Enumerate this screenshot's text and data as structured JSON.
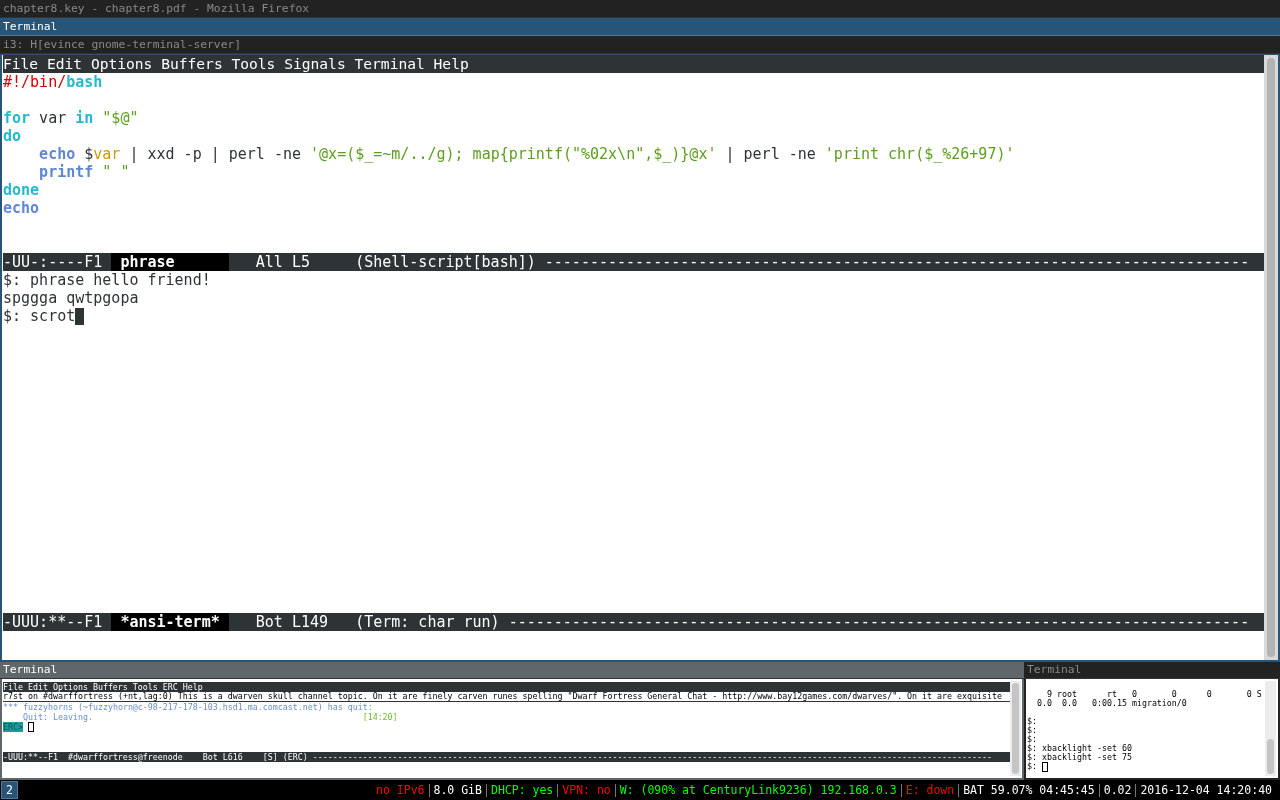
{
  "stack_titles": [
    {
      "title": "chapter8.key - chapter8.pdf - Mozilla Firefox",
      "selected": false
    },
    {
      "title": "Terminal",
      "selected": true
    },
    {
      "title": "i3: H[evince gnome-terminal-server]",
      "selected": false
    }
  ],
  "emacs": {
    "menu": [
      "File",
      "Edit",
      "Options",
      "Buffers",
      "Tools",
      "Signals",
      "Terminal",
      "Help"
    ],
    "script_buffer": {
      "lines": [
        {
          "kind": "code",
          "segments": [
            {
              "text": "#!/bin/",
              "kind": "comment"
            },
            {
              "text": "bash",
              "kind": "keyword"
            }
          ]
        },
        {
          "kind": "blank"
        },
        {
          "kind": "code",
          "segments": [
            {
              "text": "for",
              "kind": "keyword"
            },
            {
              "text": " var ",
              "kind": "plain"
            },
            {
              "text": "in",
              "kind": "keyword"
            },
            {
              "text": " \"$@\"",
              "kind": "string"
            }
          ]
        },
        {
          "kind": "code",
          "segments": [
            {
              "text": "do",
              "kind": "keyword"
            }
          ]
        },
        {
          "kind": "code",
          "segments": [
            {
              "text": "    echo",
              "kind": "builtin"
            },
            {
              "text": " $",
              "kind": "plain"
            },
            {
              "text": "var",
              "kind": "variable"
            },
            {
              "text": " | xxd -p | perl -ne ",
              "kind": "plain"
            },
            {
              "text": "'@x=($_=~m/../g); map{printf(\"%02x\\n\",$_)}@x'",
              "kind": "string"
            },
            {
              "text": " | perl -ne ",
              "kind": "plain"
            },
            {
              "text": "'print chr($_%26+97)'",
              "kind": "string"
            }
          ]
        },
        {
          "kind": "code",
          "segments": [
            {
              "text": "    printf",
              "kind": "builtin"
            },
            {
              "text": " \" \"",
              "kind": "string"
            }
          ]
        },
        {
          "kind": "code",
          "segments": [
            {
              "text": "done",
              "kind": "keyword"
            }
          ]
        },
        {
          "kind": "code",
          "segments": [
            {
              "text": "echo",
              "kind": "builtin"
            }
          ]
        }
      ]
    },
    "script_mode_line": {
      "status": "-UU-:----F1",
      "buffer": "phrase",
      "buffer_highlighted": true,
      "position": "All L5",
      "mode": "(Shell-script[bash])",
      "fill": "------------------------------------------------------------------------------"
    },
    "terminal_lines": [
      "$: phrase hello friend!",
      "spggga qwtpgopa",
      "$: scrot"
    ],
    "terminal_mode_line": {
      "status": "-UUU:**--F1",
      "buffer": "*ansi-term*",
      "buffer_highlighted": true,
      "position": "Bot L149",
      "mode": "(Term: char run)",
      "fill": "----------------------------------------------------------------------------------"
    }
  },
  "irc_window": {
    "title": "Terminal",
    "active": true,
    "menu": [
      "File",
      "Edit",
      "Options",
      "Buffers",
      "Tools",
      "ERC",
      "Help"
    ],
    "topic": "r7st on #dwarffortress (+nt,lag:0) This is a dwarven skull channel topic. On it are finely carven runes spelling \"Dwarf Fortress General Chat - http://www.bay12games.com/dwarves/\". On it are exquisite",
    "messages": [
      {
        "text": "*** fuzzyhorns (~fuzzyhorn@c-98-217-178-103.hsd1.ma.comcast.net) has quit:"
      },
      {
        "text": "    Quit: Leaving.",
        "time": "[14:20]"
      }
    ],
    "prompt": "ERC>",
    "mode_line": {
      "status": "-UUU:**--F1",
      "buffer": "#dwarffortress@freenode",
      "buffer_highlighted": false,
      "position": "Bot L616",
      "mode": "[S] (ERC)",
      "fill": "----------------------------------------------------------------------------------------------------------------------------------------"
    }
  },
  "shell_window": {
    "title": "Terminal",
    "active": false,
    "lines": [
      {
        "kind": "text",
        "text": "    9 root      rt   0       0      0       0 S"
      },
      {
        "kind": "text",
        "text": "  0.0  0.0   0:00.15 migration/0"
      },
      {
        "kind": "blank"
      },
      {
        "kind": "text",
        "text": "$:"
      },
      {
        "kind": "text",
        "text": "$:"
      },
      {
        "kind": "text",
        "text": "$:"
      },
      {
        "kind": "text",
        "text": "$: xbacklight -set 60"
      },
      {
        "kind": "text",
        "text": "$: xbacklight -set 75"
      },
      {
        "kind": "text",
        "text": "$:"
      }
    ]
  },
  "status_bar": {
    "workspaces": [
      {
        "label": "2",
        "selected": true
      }
    ],
    "items": [
      {
        "text": "no IPv6",
        "color": "#ff0000"
      },
      {
        "text": "8.0 GiB",
        "color": "#ffffff"
      },
      {
        "text": "DHCP: yes",
        "color": "#00ff00"
      },
      {
        "text": "VPN: no",
        "color": "#ff0000"
      },
      {
        "text": "W: (090% at CenturyLink9236) 192.168.0.3",
        "color": "#00ff00"
      },
      {
        "text": "E: down",
        "color": "#ff0000"
      },
      {
        "text": "BAT 59.07% 04:45:45",
        "color": "#ffffff"
      },
      {
        "text": "0.02",
        "color": "#ffffff"
      },
      {
        "text": "2016-12-04 14:20:40",
        "color": "#ffffff"
      }
    ]
  }
}
